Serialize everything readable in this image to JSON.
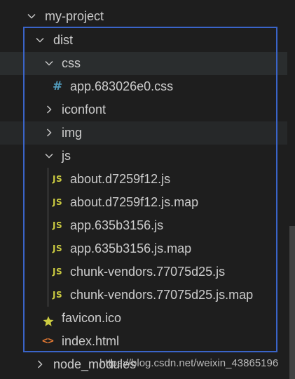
{
  "explorer": {
    "root": {
      "label": "my-project",
      "icon": "chevron-down-icon"
    },
    "dist": {
      "label": "dist",
      "icon": "chevron-down-icon"
    },
    "css": {
      "label": "css",
      "icon": "chevron-down-icon"
    },
    "css_file": {
      "label": "app.683026e0.css",
      "icon": "css-hash-icon",
      "glyph": "#"
    },
    "iconfont": {
      "label": "iconfont",
      "icon": "chevron-right-icon"
    },
    "img": {
      "label": "img",
      "icon": "chevron-right-icon"
    },
    "js": {
      "label": "js",
      "icon": "chevron-down-icon"
    },
    "js_icon_glyph": "JS",
    "js_files": [
      {
        "label": "about.d7259f12.js"
      },
      {
        "label": "about.d7259f12.js.map"
      },
      {
        "label": "app.635b3156.js"
      },
      {
        "label": "app.635b3156.js.map"
      },
      {
        "label": "chunk-vendors.77075d25.js"
      },
      {
        "label": "chunk-vendors.77075d25.js.map"
      }
    ],
    "favicon": {
      "label": "favicon.ico",
      "icon": "star-icon"
    },
    "index_html": {
      "label": "index.html",
      "icon": "html-icon",
      "glyph": "<>"
    },
    "node_modules": {
      "label": "node_modules",
      "icon": "chevron-right-icon"
    }
  },
  "watermark": "https://blog.csdn.net/weixin_43865196",
  "colors": {
    "background": "#1e1e1e",
    "text": "#cccccc",
    "hover_row": "#2a2d2e",
    "js_icon": "#cbcb41",
    "css_icon": "#519aba",
    "favicon_star": "#cbcb41",
    "html_icon": "#e37933",
    "selection_border": "#3a64c8"
  }
}
